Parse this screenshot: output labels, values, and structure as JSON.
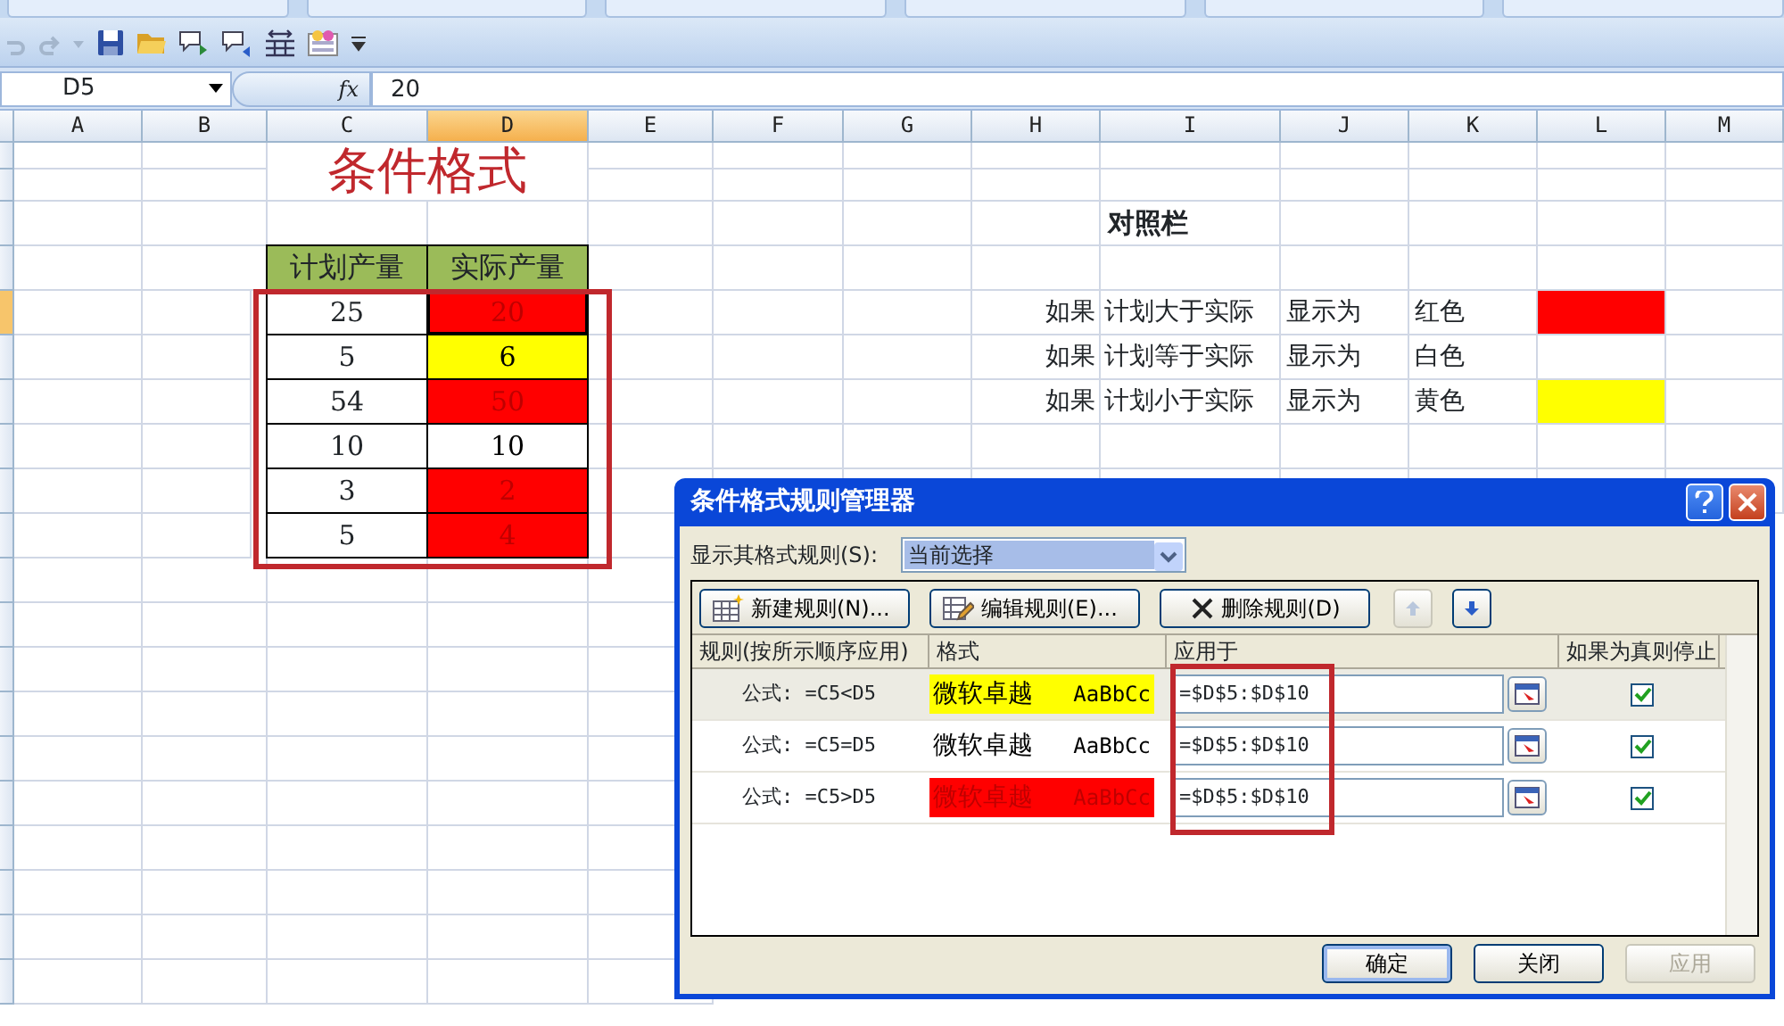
{
  "name_box": {
    "value": "D5"
  },
  "function_label": "fx",
  "formula_bar": {
    "value": "20"
  },
  "columns": [
    {
      "label": "A",
      "selected": false
    },
    {
      "label": "B",
      "selected": false
    },
    {
      "label": "C",
      "selected": false
    },
    {
      "label": "D",
      "selected": true
    },
    {
      "label": "E",
      "selected": false
    },
    {
      "label": "F",
      "selected": false
    },
    {
      "label": "G",
      "selected": false
    },
    {
      "label": "H",
      "selected": false
    },
    {
      "label": "I",
      "selected": false
    },
    {
      "label": "J",
      "selected": false
    },
    {
      "label": "K",
      "selected": false
    },
    {
      "label": "L",
      "selected": false
    },
    {
      "label": "M",
      "selected": false
    }
  ],
  "row_headers": [
    {
      "selected": false
    },
    {
      "selected": false
    },
    {
      "selected": false
    },
    {
      "selected": false
    },
    {
      "selected": true
    },
    {
      "selected": false
    },
    {
      "selected": false
    },
    {
      "selected": false
    },
    {
      "selected": false
    },
    {
      "selected": false
    },
    {
      "selected": false
    },
    {
      "selected": false
    },
    {
      "selected": false
    },
    {
      "selected": false
    },
    {
      "selected": false
    },
    {
      "selected": false
    },
    {
      "selected": false
    },
    {
      "selected": false
    },
    {
      "selected": false
    },
    {
      "selected": false
    }
  ],
  "sheet_title": "条件格式",
  "table": {
    "columns": [
      "计划产量",
      "实际产量"
    ],
    "rows": [
      {
        "planned": "25",
        "actual": "20",
        "color": "#ff0000",
        "selected": true
      },
      {
        "planned": "5",
        "actual": "6",
        "color": "#ffff00",
        "selected": false
      },
      {
        "planned": "54",
        "actual": "50",
        "color": "#ff0000",
        "selected": false
      },
      {
        "planned": "10",
        "actual": "10",
        "color": "#ffffff",
        "selected": false
      },
      {
        "planned": "3",
        "actual": "2",
        "color": "#ff0000",
        "selected": false
      },
      {
        "planned": "5",
        "actual": "4",
        "color": "#ff0000",
        "selected": false
      }
    ]
  },
  "legend": {
    "title": "对照栏",
    "rows": [
      {
        "prefix": "如果",
        "condition": "计划大于实际",
        "verb": "显示为",
        "color_name": "红色",
        "color": "#ff0000"
      },
      {
        "prefix": "如果",
        "condition": "计划等于实际",
        "verb": "显示为",
        "color_name": "白色",
        "color": "#ffffff"
      },
      {
        "prefix": "如果",
        "condition": "计划小于实际",
        "verb": "显示为",
        "color_name": "黄色",
        "color": "#ffff00"
      }
    ]
  },
  "dialog": {
    "title": "条件格式规则管理器",
    "show_rules_label": "显示其格式规则(S):",
    "show_rules_value": "当前选择",
    "buttons": [
      {
        "kind": "new",
        "label": "新建规则(N)..."
      },
      {
        "kind": "edit",
        "label": "编辑规则(E)..."
      },
      {
        "kind": "delete",
        "label": "删除规则(D)"
      }
    ],
    "move_buttons": [
      {
        "kind": "up",
        "disabled": true
      },
      {
        "kind": "down",
        "disabled": false
      }
    ],
    "columns": [
      "规则(按所示顺序应用)",
      "格式",
      "应用于",
      "如果为真则停止"
    ],
    "rules": [
      {
        "rule": "公式: =C5<D5",
        "sample": "微软卓越",
        "sample_latin": "AaBbCc",
        "color": "#ffff00",
        "applies_to": "=$D$5:$D$10",
        "stop_if_true": true,
        "selected": true
      },
      {
        "rule": "公式: =C5=D5",
        "sample": "微软卓越",
        "sample_latin": "AaBbCc",
        "color": "#ffffff",
        "applies_to": "=$D$5:$D$10",
        "stop_if_true": true,
        "selected": false
      },
      {
        "rule": "公式: =C5>D5",
        "sample": "微软卓越",
        "sample_latin": "AaBbCc",
        "color": "#ff0000",
        "applies_to": "=$D$5:$D$10",
        "stop_if_true": true,
        "selected": false
      }
    ],
    "footer_buttons": [
      {
        "label": "确定",
        "default": true,
        "disabled": false
      },
      {
        "label": "关闭",
        "default": false,
        "disabled": false
      },
      {
        "label": "应用",
        "default": false,
        "disabled": true
      }
    ]
  }
}
